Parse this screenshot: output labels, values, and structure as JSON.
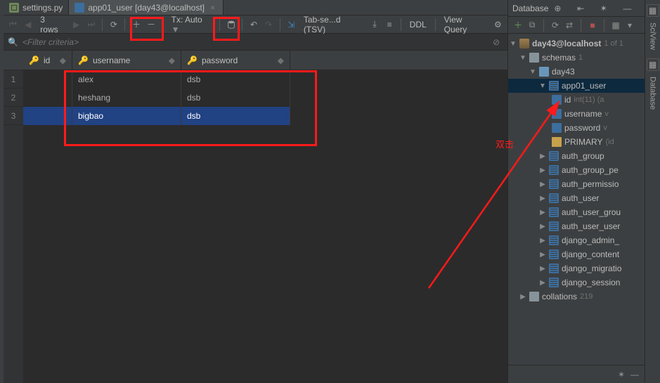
{
  "tabs": [
    {
      "label": "settings.py",
      "type": "file"
    },
    {
      "label": "app01_user [day43@localhost]",
      "type": "table"
    }
  ],
  "toolbar": {
    "rows_label": "3 rows",
    "tx_label": "Tx: Auto",
    "tab_label": "Tab-se...d (TSV)",
    "ddl": "DDL",
    "view_query": "View Query"
  },
  "filter": {
    "placeholder": "<Filter criteria>"
  },
  "columns": [
    {
      "name": "id",
      "width": 60,
      "key": true
    },
    {
      "name": "username",
      "width": 155,
      "key": true
    },
    {
      "name": "password",
      "width": 155
    }
  ],
  "rows": [
    {
      "n": "1",
      "username": "alex",
      "password": "dsb",
      "sel": false
    },
    {
      "n": "2",
      "username": "heshang",
      "password": "dsb",
      "sel": false
    },
    {
      "n": "3",
      "username": "bigbao",
      "password": "dsb",
      "sel": true
    }
  ],
  "dbpanel": {
    "title": "Database",
    "ds": "day43@localhost",
    "ds_sub": "1 of 1",
    "schemas_label": "schemas",
    "schemas_sub": "1",
    "db": "day43",
    "active_table": "app01_user",
    "cols": [
      {
        "icon": "col",
        "label": "id",
        "sub": "int(11) (a"
      },
      {
        "icon": "col",
        "label": "username",
        "sub": "v"
      },
      {
        "icon": "col",
        "label": "password",
        "sub": "v"
      },
      {
        "icon": "key",
        "label": "PRIMARY",
        "sub": "(id"
      }
    ],
    "tables": [
      "auth_group",
      "auth_group_pe",
      "auth_permissio",
      "auth_user",
      "auth_user_grou",
      "auth_user_user",
      "django_admin_",
      "django_content",
      "django_migratio",
      "django_session"
    ],
    "collations_label": "collations",
    "collations_sub": "219"
  },
  "rstrip": {
    "label1": "SciView",
    "label2": "Database"
  },
  "annotation": "双击"
}
